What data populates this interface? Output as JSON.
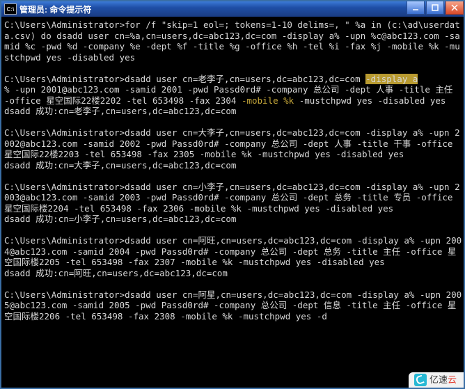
{
  "window": {
    "sysicon_text": "C:\\",
    "title": "管理员: 命令提示符"
  },
  "prompt": "C:\\Users\\Administrator>",
  "blocks": [
    {
      "cmd_lines": [
        "for /f \"skip=1 eol=; tokens=1-10 delims=, \" %a in (c:\\ad\\userdata.csv) do dsadd user cn=%a,cn=users,dc=abc123,dc=com -display a% -upn %c@abc123.com -samid %c -pwd %d -company %e -dept %f -title %g -office %h -tel %i -fax %j -mobile %k -mustchpwd yes -disabled yes"
      ],
      "result": ""
    },
    {
      "cmd_hl_display": "dsadd user cn=老李子,cn=users,dc=abc123,dc=com -display a",
      "cmd_rest_lines": [
        "% -upn 2001@abc123.com -samid 2001 -pwd Passd0rd# -company 总公司 -dept 人事 -title 主任 -office 星空国际22楼2202 -tel 653498 -fax 2304 ",
        " -mustchpwd yes -disabled yes"
      ],
      "mobile_hl": "-mobile %k",
      "result": "dsadd 成功:cn=老李子,cn=users,dc=abc123,dc=com"
    },
    {
      "cmd_lines": [
        "dsadd user cn=大李子,cn=users,dc=abc123,dc=com -display a% -upn 2002@abc123.com -samid 2002 -pwd Passd0rd# -company 总公司 -dept 人事 -title 干事 -office 星空国际22楼2203 -tel 653498 -fax 2305 -mobile %k -mustchpwd yes -disabled yes"
      ],
      "result": "dsadd 成功:cn=大李子,cn=users,dc=abc123,dc=com"
    },
    {
      "cmd_lines": [
        "dsadd user cn=小李子,cn=users,dc=abc123,dc=com -display a% -upn 2003@abc123.com -samid 2003 -pwd Passd0rd# -company 总公司 -dept 总务 -title 专员 -office 星空国际楼2204 -tel 653498 -fax 2306 -mobile %k -mustchpwd yes -disabled yes"
      ],
      "result": "dsadd 成功:cn=小李子,cn=users,dc=abc123,dc=com"
    },
    {
      "cmd_lines": [
        "dsadd user cn=阿旺,cn=users,dc=abc123,dc=com -display a% -upn 2004@abc123.com -samid 2004 -pwd Passd0rd# -company 总公司 -dept 总务 -title 主任 -office 星空国际楼2205 -tel 653498 -fax 2307 -mobile %k -mustchpwd yes -disabled yes"
      ],
      "result": "dsadd 成功:cn=阿旺,cn=users,dc=abc123,dc=com"
    },
    {
      "cmd_lines": [
        "dsadd user cn=阿星,cn=users,dc=abc123,dc=com -display a% -upn 2005@abc123.com -samid 2005 -pwd Passd0rd# -company 总公司 -dept 信息 -title 主任 -office 星空国际楼2206 -tel 653498 -fax 2308 -mobile %k -mustchpwd yes -d"
      ],
      "result": ""
    }
  ],
  "watermark": {
    "brand_prefix": "亿速",
    "brand_suffix": "云"
  }
}
